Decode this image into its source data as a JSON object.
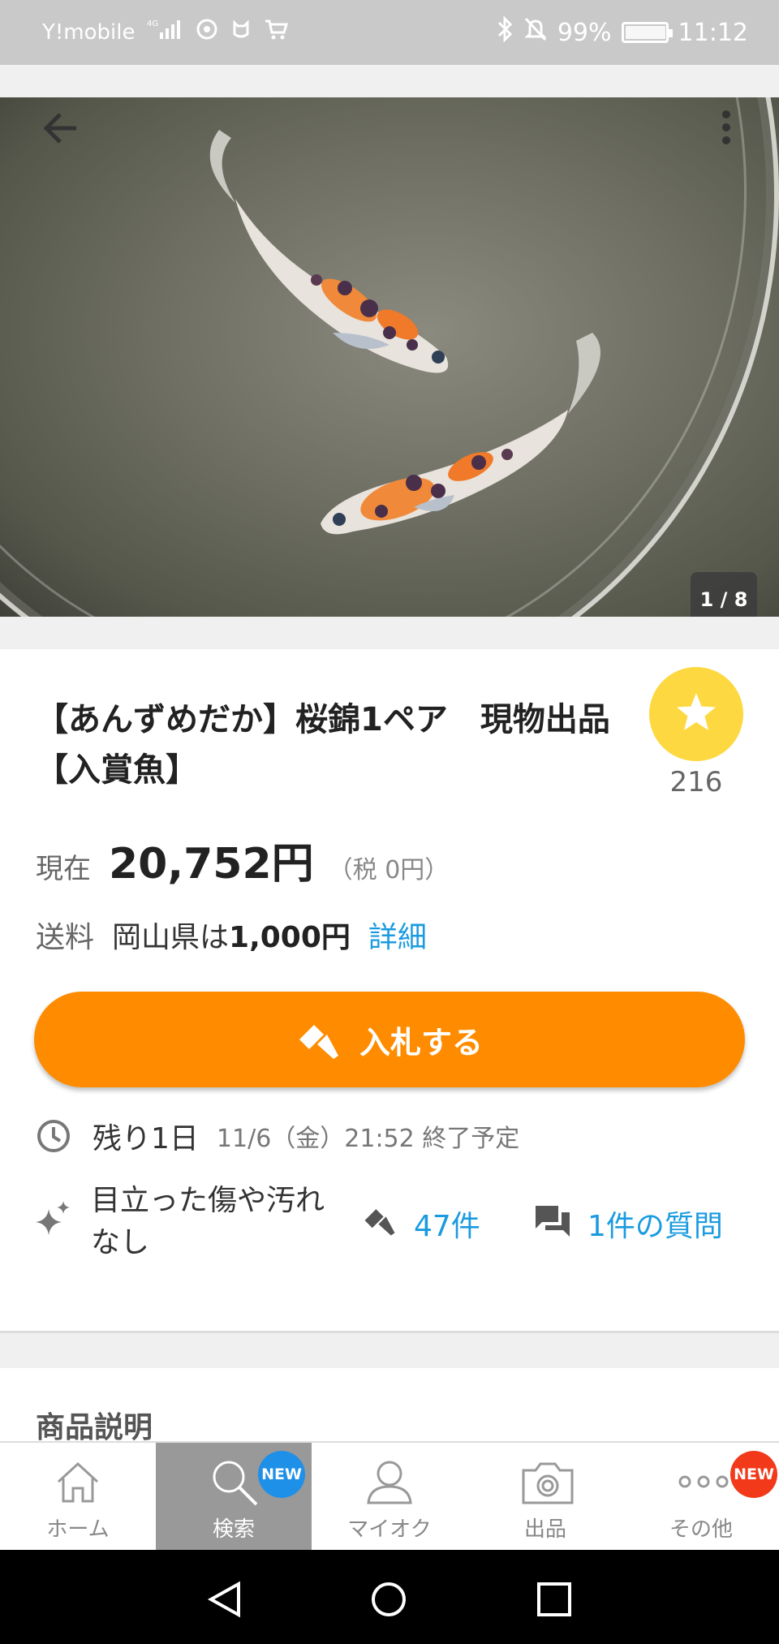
{
  "status_bar": {
    "carrier": "Y!mobile",
    "network": "4G",
    "battery": "99%",
    "time": "11:12"
  },
  "header": {
    "back_icon": "arrow-left-icon",
    "more_icon": "more-vertical-icon"
  },
  "gallery": {
    "counter": "1 / 8"
  },
  "product": {
    "title": "【あんずめだか】桜錦1ペア　現物出品【入賞魚】",
    "watch_count": "216",
    "price_label": "現在",
    "price": "20,752円",
    "tax": "（税 0円）",
    "shipping_label": "送料",
    "shipping_prefecture": "岡山県は",
    "shipping_cost": "1,000円",
    "shipping_detail_link": "詳細"
  },
  "bid_button": {
    "label": "入札する",
    "color": "#ff8c00"
  },
  "timing": {
    "remaining": "残り1日",
    "end": "11/6（金）21:52 終了予定"
  },
  "info": {
    "condition": "目立った傷や汚れなし",
    "bids": "47件",
    "questions": "1件の質問"
  },
  "description": {
    "heading": "商品説明"
  },
  "bottom_nav": {
    "items": [
      {
        "label": "ホーム",
        "icon": "home-icon"
      },
      {
        "label": "検索",
        "icon": "search-icon",
        "badge": "NEW",
        "active": true
      },
      {
        "label": "マイオク",
        "icon": "person-icon"
      },
      {
        "label": "出品",
        "icon": "camera-icon"
      },
      {
        "label": "その他",
        "icon": "more-horizontal-icon",
        "badge": "NEW"
      }
    ]
  },
  "colors": {
    "accent": "#ff8c00",
    "link": "#1a9be0",
    "watch": "#fdd840"
  }
}
